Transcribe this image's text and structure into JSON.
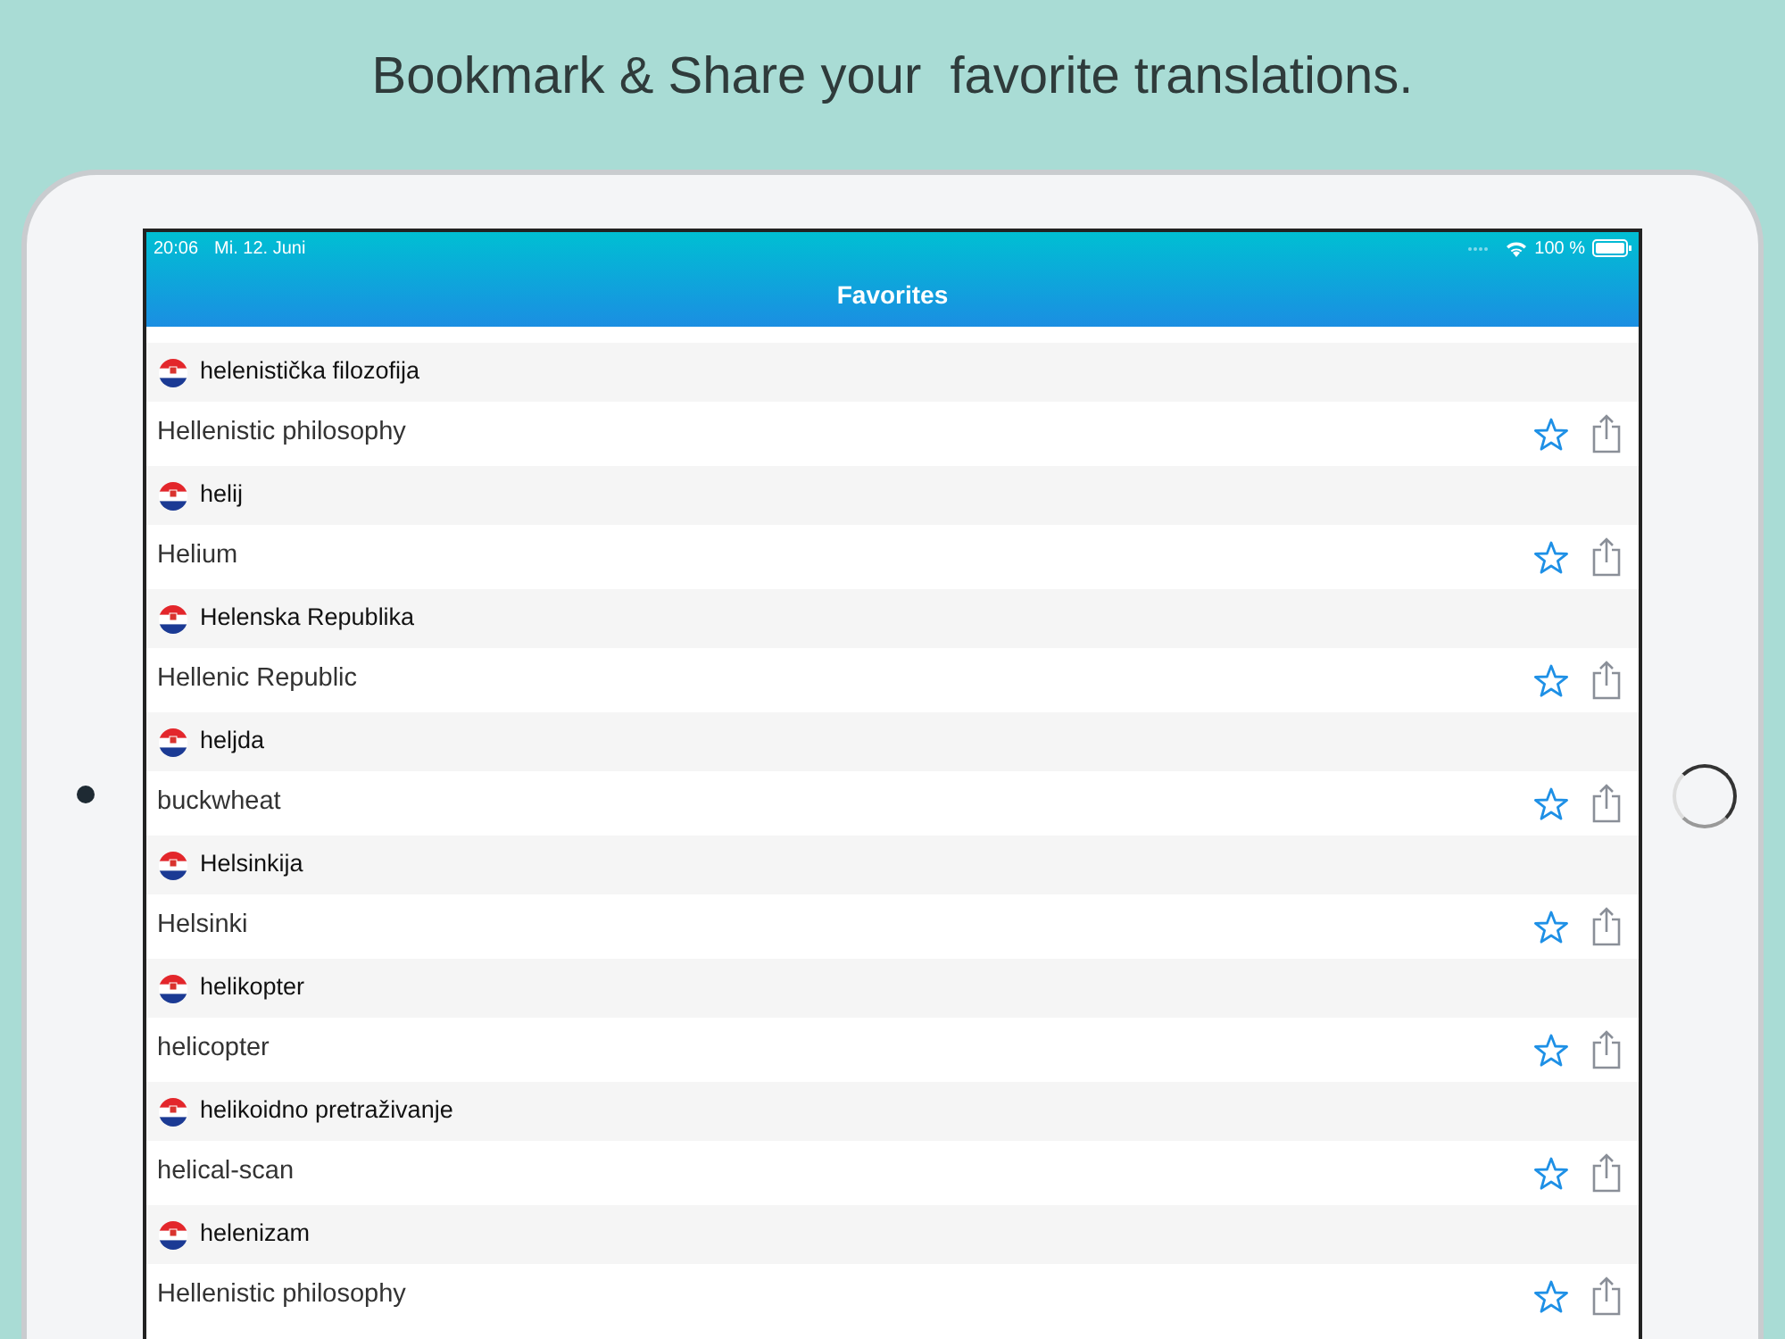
{
  "headline": "Bookmark & Share your  favorite translations.",
  "status_bar": {
    "time": "20:06",
    "date": "Mi. 12. Juni",
    "battery": "100 %"
  },
  "nav_bar": {
    "title": "Favorites"
  },
  "favorites": [
    {
      "term": "helenistička filozofija",
      "translation": "Hellenistic philosophy"
    },
    {
      "term": "helij",
      "translation": "Helium"
    },
    {
      "term": "Helenska Republika",
      "translation": "Hellenic Republic"
    },
    {
      "term": "heljda",
      "translation": "buckwheat"
    },
    {
      "term": "Helsinkija",
      "translation": "Helsinki"
    },
    {
      "term": "helikopter",
      "translation": "helicopter"
    },
    {
      "term": "helikoidno pretraživanje",
      "translation": "helical-scan"
    },
    {
      "term": "helenizam",
      "translation": "Hellenistic philosophy"
    }
  ]
}
